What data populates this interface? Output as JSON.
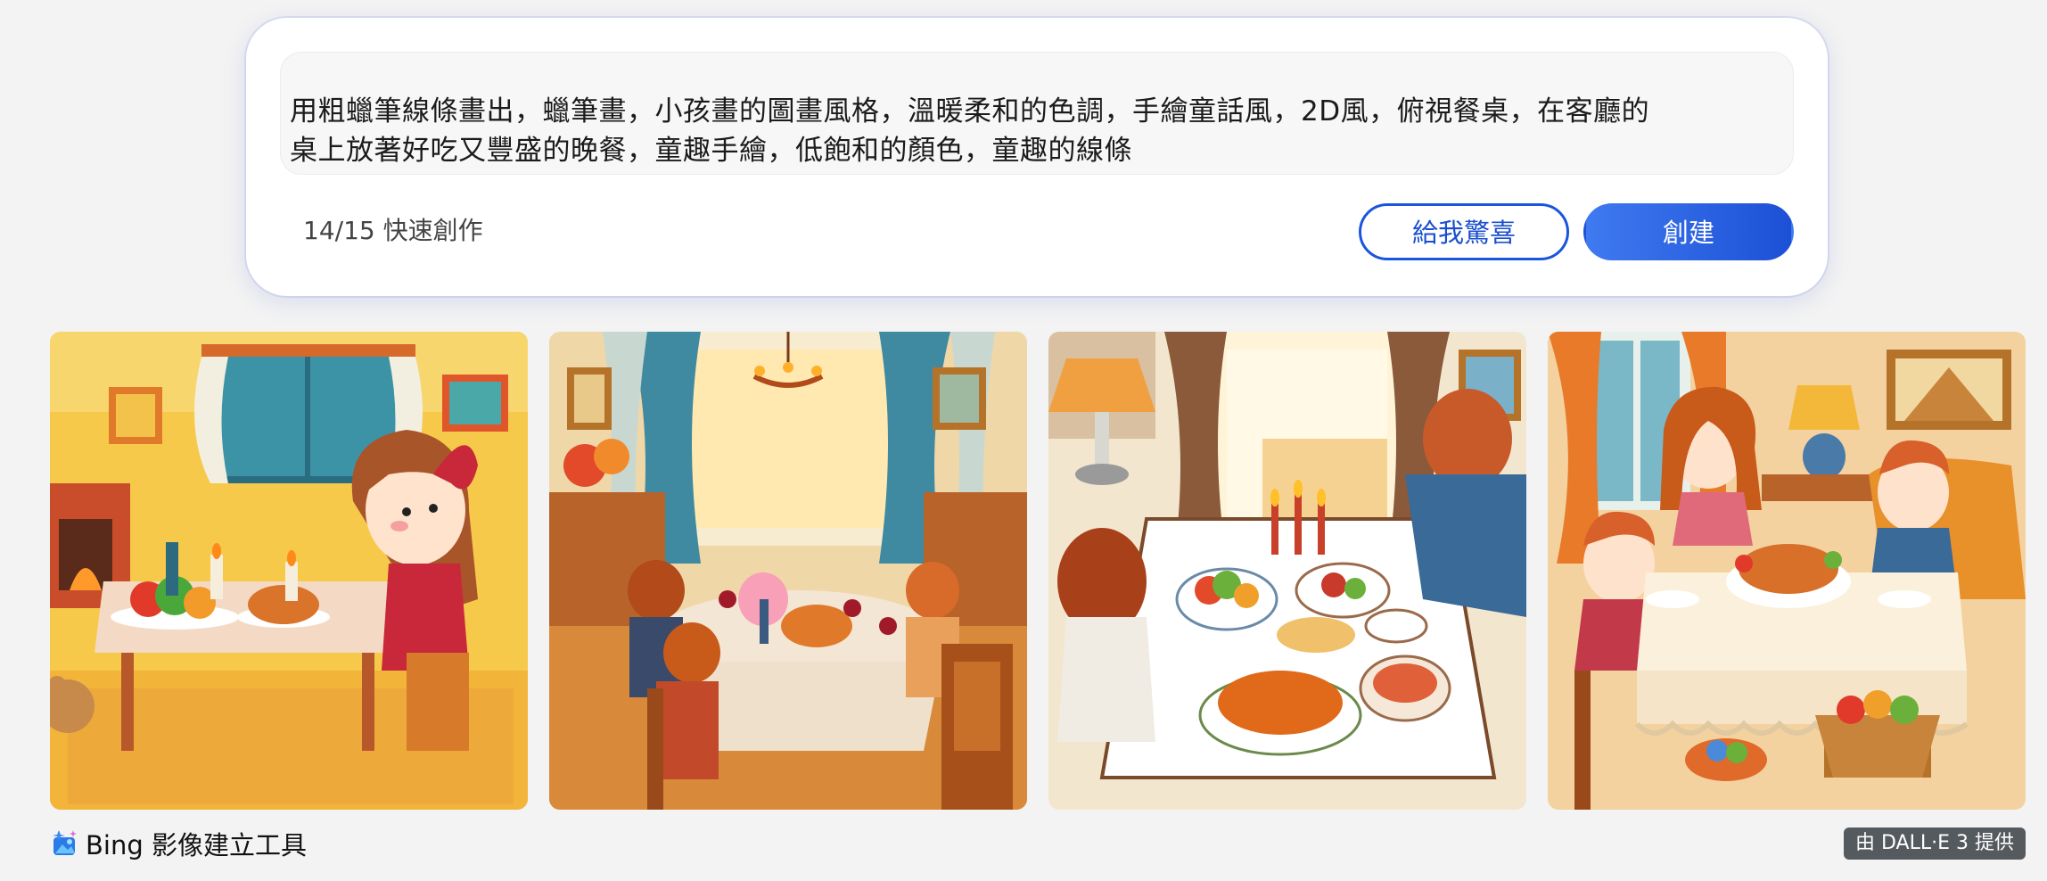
{
  "prompt": {
    "text": "用粗蠟筆線條畫出，蠟筆畫，小孩畫的圖畫風格，溫暖柔和的色調，手繪童話風，2D風，俯視餐桌，在客廳的\n桌上放著好吃又豐盛的晚餐，童趣手繪，低飽和的顏色，童趣的線條",
    "counter": "14/15 快速創作",
    "surprise_label": "給我驚喜",
    "create_label": "創建"
  },
  "images": [
    {
      "name": "generated-image-1"
    },
    {
      "name": "generated-image-2"
    },
    {
      "name": "generated-image-3"
    },
    {
      "name": "generated-image-4"
    }
  ],
  "footer": {
    "brand_icon": "image-creator-icon",
    "brand_label": "Bing 影像建立工具",
    "badge_label": "由 DALL·E 3 提供"
  },
  "colors": {
    "accent": "#1a55dc",
    "create_gradient_start": "#3f7af0",
    "create_gradient_end": "#1c50d6",
    "badge_bg": "#555a5f",
    "page_bg": "#f3f3f3"
  }
}
